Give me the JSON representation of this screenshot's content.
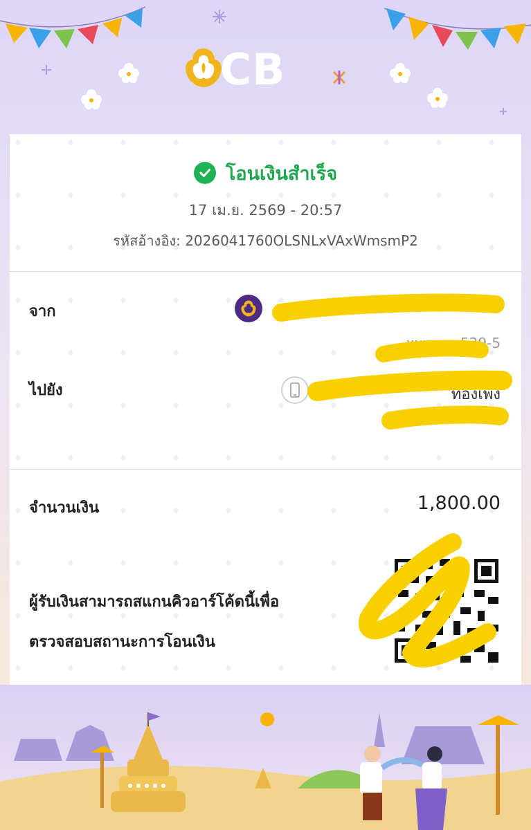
{
  "header": {
    "brand": "SCB",
    "logo_icon": "scb-lotus-icon"
  },
  "status": {
    "icon": "check-circle-icon",
    "text": "โอนเงินสำเร็จ",
    "datetime": "17 เม.ย. 2569 - 20:57",
    "reference_label": "รหัสอ้างอิง:",
    "reference_value": "2026041760OLSNLxVAxWmsmP2"
  },
  "transfer": {
    "from_label": "จาก",
    "from_bank_icon": "scb-lotus-icon",
    "from_account_partial": "xxx-xxx529-5",
    "to_label": "ไปยัง",
    "to_icon": "mobile-phone-icon",
    "to_partial": "ทองเพ็ง"
  },
  "amount": {
    "label": "จำนวนเงิน",
    "value": "1,800.00"
  },
  "qr": {
    "note_line1": "ผู้รับเงินสามารถสแกนคิวอาร์โค้ดนี้เพื่อ",
    "note_line2": "ตรวจสอบสถานะการโอนเงิน"
  },
  "colors": {
    "success": "#1fb155",
    "brand_purple": "#4e2a84",
    "brand_gold": "#f2b41c",
    "redaction": "#f8d000"
  }
}
